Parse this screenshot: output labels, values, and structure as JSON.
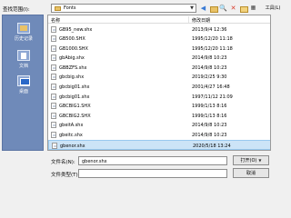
{
  "toolbar": {
    "look_in_label": "查找范围(I):",
    "look_in_value": "Fonts",
    "tools_label": "工具(L)"
  },
  "places": [
    {
      "label": "历史记录",
      "icon": "history-icon"
    },
    {
      "label": "文档",
      "icon": "documents-icon"
    },
    {
      "label": "桌面",
      "icon": "desktop-icon"
    }
  ],
  "list": {
    "col_name": "名称",
    "col_date": "修改日期",
    "files": [
      {
        "name": "GB95_new.shx",
        "date": "2013/9/4 12:36"
      },
      {
        "name": "GB500.SHX",
        "date": "1995/12/20 11:18"
      },
      {
        "name": "GB1000.SHX",
        "date": "1995/12/20 11:18"
      },
      {
        "name": "gbAbig.shx",
        "date": "2014/9/8 10:23"
      },
      {
        "name": "GBBZFS.shx",
        "date": "2014/9/8 10:23"
      },
      {
        "name": "gbcbig.shx",
        "date": "2019/2/25 9:30"
      },
      {
        "name": "gbcbig01.shx",
        "date": "2001/4/27 16:48"
      },
      {
        "name": "gbcbig01.shx",
        "date": "1997/11/12 21:09"
      },
      {
        "name": "GBCBIG1.SHX",
        "date": "1999/1/13 8:16"
      },
      {
        "name": "GBCBIG2.SHX",
        "date": "1999/1/13 8:16"
      },
      {
        "name": "gbeitA.shx",
        "date": "2014/9/8 10:23"
      },
      {
        "name": "gbeitc.shx",
        "date": "2014/9/8 10:23"
      },
      {
        "name": "gbenor.shx",
        "date": "2020/5/18 13:24"
      }
    ],
    "selected_index": 12
  },
  "bottom": {
    "filename_label": "文件名(N):",
    "filename_value": "gbenor.shx",
    "filetype_label": "文件类型(T):",
    "open_label": "打开(O)",
    "cancel_label": "取消"
  }
}
